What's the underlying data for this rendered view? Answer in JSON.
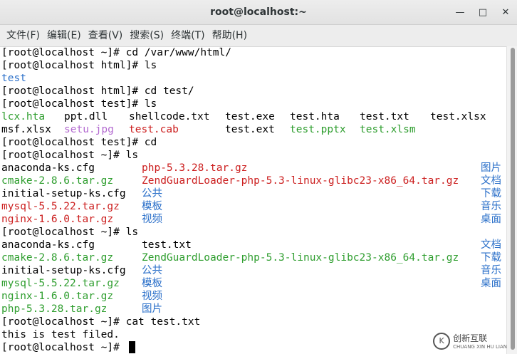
{
  "window": {
    "title": "root@localhost:~"
  },
  "menubar": [
    "文件(F)",
    "编辑(E)",
    "查看(V)",
    "搜索(S)",
    "终端(T)",
    "帮助(H)"
  ],
  "terminal": {
    "lines": [
      [
        {
          "text": "[root@localhost ~]# cd /var/www/html/",
          "color": "default"
        }
      ],
      [
        {
          "text": "[root@localhost html]# ls",
          "color": "default"
        }
      ],
      [
        {
          "text": "test",
          "color": "blue"
        }
      ],
      [
        {
          "text": "[root@localhost html]# cd test/",
          "color": "default"
        }
      ],
      [
        {
          "text": "[root@localhost test]# ls",
          "color": "default"
        }
      ],
      [
        {
          "text": "lcx.hta",
          "color": "green"
        },
        {
          "text": "ppt.dll",
          "color": "default"
        },
        {
          "text": "shellcode.txt",
          "color": "default"
        },
        {
          "text": "test.exe",
          "color": "default"
        },
        {
          "text": "test.hta",
          "color": "default"
        },
        {
          "text": "test.txt",
          "color": "default"
        },
        {
          "text": "test.xlsx",
          "color": "default"
        }
      ],
      [
        {
          "text": "msf.xlsx",
          "color": "default"
        },
        {
          "text": "setu.jpg",
          "color": "pink"
        },
        {
          "text": "test.cab",
          "color": "red"
        },
        {
          "text": "test.ext",
          "color": "default"
        },
        {
          "text": "test.pptx",
          "color": "green"
        },
        {
          "text": "test.xlsm",
          "color": "green"
        }
      ],
      [
        {
          "text": "[root@localhost test]# cd",
          "color": "default"
        }
      ],
      [
        {
          "text": "[root@localhost ~]# ls",
          "color": "default"
        }
      ],
      [
        {
          "text": "anaconda-ks.cfg",
          "color": "default"
        },
        {
          "text": "php-5.3.28.tar.gz",
          "color": "red"
        },
        {
          "text": "图片",
          "color": "blue"
        }
      ],
      [
        {
          "text": "cmake-2.8.6.tar.gz",
          "color": "green"
        },
        {
          "text": "ZendGuardLoader-php-5.3-linux-glibc23-x86_64.tar.gz",
          "color": "red"
        },
        {
          "text": "文档",
          "color": "blue"
        }
      ],
      [
        {
          "text": "initial-setup-ks.cfg",
          "color": "default"
        },
        {
          "text": "公共",
          "color": "blue"
        },
        {
          "text": "下载",
          "color": "blue"
        }
      ],
      [
        {
          "text": "mysql-5.5.22.tar.gz",
          "color": "red"
        },
        {
          "text": "模板",
          "color": "blue"
        },
        {
          "text": "音乐",
          "color": "blue"
        }
      ],
      [
        {
          "text": "nginx-1.6.0.tar.gz",
          "color": "red"
        },
        {
          "text": "视频",
          "color": "blue"
        },
        {
          "text": "桌面",
          "color": "blue"
        }
      ],
      [
        {
          "text": "[root@localhost ~]# ls",
          "color": "default"
        }
      ],
      [
        {
          "text": "anaconda-ks.cfg",
          "color": "default"
        },
        {
          "text": "test.txt",
          "color": "default"
        },
        {
          "text": "文档",
          "color": "blue"
        }
      ],
      [
        {
          "text": "cmake-2.8.6.tar.gz",
          "color": "green"
        },
        {
          "text": "ZendGuardLoader-php-5.3-linux-glibc23-x86_64.tar.gz",
          "color": "green"
        },
        {
          "text": "下载",
          "color": "blue"
        }
      ],
      [
        {
          "text": "initial-setup-ks.cfg",
          "color": "default"
        },
        {
          "text": "公共",
          "color": "blue"
        },
        {
          "text": "音乐",
          "color": "blue"
        }
      ],
      [
        {
          "text": "mysql-5.5.22.tar.gz",
          "color": "green"
        },
        {
          "text": "模板",
          "color": "blue"
        },
        {
          "text": "桌面",
          "color": "blue"
        }
      ],
      [
        {
          "text": "nginx-1.6.0.tar.gz",
          "color": "green"
        },
        {
          "text": "视频",
          "color": "blue"
        }
      ],
      [
        {
          "text": "php-5.3.28.tar.gz",
          "color": "green"
        },
        {
          "text": "图片",
          "color": "blue"
        }
      ],
      [
        {
          "text": "[root@localhost ~]# cat test.txt",
          "color": "default"
        }
      ],
      [
        {
          "text": "this is test filed.",
          "color": "default"
        }
      ],
      [
        {
          "text": "[root@localhost ~]# ",
          "color": "default"
        }
      ]
    ]
  },
  "watermark": {
    "name": "创新互联",
    "sub": "CHUANG XIN HU LIAN"
  },
  "colors": {
    "blue": "#2a6fc9",
    "green": "#2f9e2f",
    "red": "#cc1f1f",
    "pink": "#b36ad0"
  }
}
